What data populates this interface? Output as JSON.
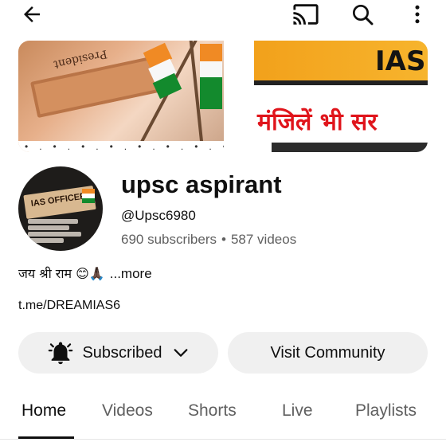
{
  "topbar": {
    "back_icon": "arrow-left-icon",
    "cast_icon": "cast-icon",
    "search_icon": "search-icon",
    "more_icon": "more-vertical-icon"
  },
  "banner": {
    "plaque_text": "President",
    "ias_text": "IAS",
    "hindi_heading": "मंजिलें भी सर"
  },
  "avatar": {
    "plate_text": "IAS OFFICER"
  },
  "channel": {
    "name": "upsc aspirant",
    "handle": "@Upsc6980",
    "subscribers": "690 subscribers",
    "separator": "•",
    "videos": "587 videos",
    "description": "जय श्री राम 😊🙏🏿",
    "more_label": "...more",
    "link": "t.me/DREAMIAS6"
  },
  "buttons": {
    "subscribed_label": "Subscribed",
    "community_label": "Visit Community"
  },
  "tabs": [
    {
      "label": "Home",
      "active": true
    },
    {
      "label": "Videos"
    },
    {
      "label": "Shorts"
    },
    {
      "label": "Live"
    },
    {
      "label": "Playlists"
    }
  ],
  "colors": {
    "text_primary": "#0f0f0f",
    "text_secondary": "#606060",
    "button_bg": "#f0f0f0",
    "accent_red": "#e0151c"
  }
}
